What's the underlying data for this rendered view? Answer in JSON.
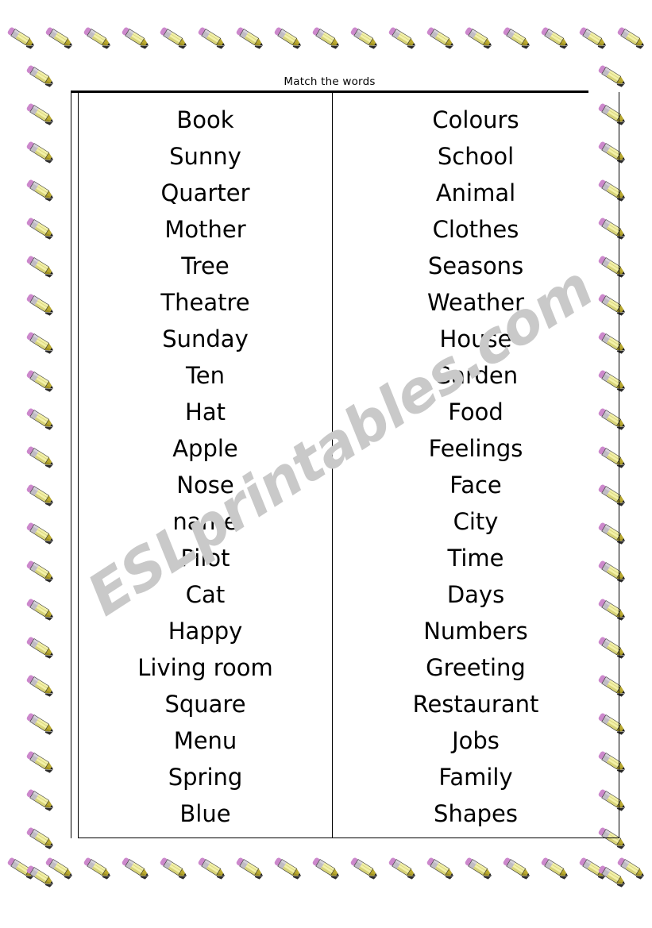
{
  "worksheet": {
    "title": "Match the words",
    "watermark": "ESLprintables.com",
    "border_icon": "pencil-icon",
    "colors": {
      "pencil_eraser": "#cc88cc",
      "pencil_ferrule": "#c0bcc4",
      "pencil_body": "#f2f0a8",
      "pencil_body_shade": "#d8d47a",
      "pencil_tip_wood": "#b8a830",
      "pencil_lead": "#1a1a1a",
      "rule": "#000000",
      "watermark": "#c9c9c9",
      "page": "#ffffff"
    }
  },
  "columns": {
    "left": [
      "Book",
      "Sunny",
      "Quarter",
      "Mother",
      "Tree",
      "Theatre",
      "Sunday",
      "Ten",
      "Hat",
      "Apple",
      "Nose",
      "name",
      "Pilot",
      "Cat",
      "Happy",
      "Living room",
      "Square",
      "Menu",
      "Spring",
      "Blue"
    ],
    "right": [
      "Colours",
      "School",
      "Animal",
      "Clothes",
      "Seasons",
      "Weather",
      "House",
      "Garden",
      "Food",
      "Feelings",
      "Face",
      "City",
      "Time",
      "Days",
      "Numbers",
      "Greeting",
      "Restaurant",
      "Jobs",
      "Family",
      "Shapes"
    ]
  }
}
